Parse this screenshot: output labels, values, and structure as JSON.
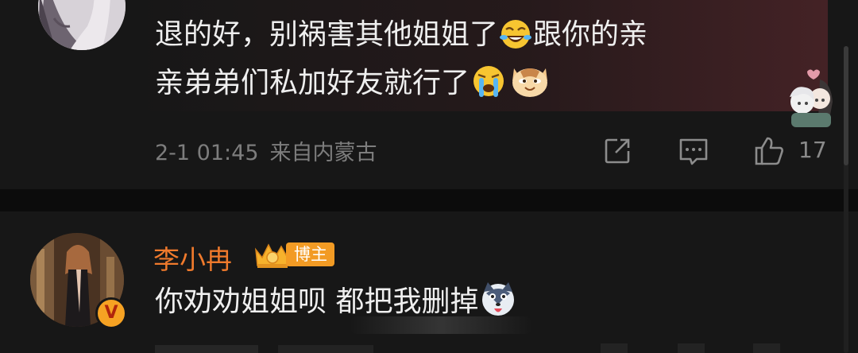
{
  "comment_top": {
    "text_line1_part1": "退的好，别祸害其他姐姐了",
    "text_line1_emoji": "laughing-crying-emoji",
    "text_line1_part2": "跟你的亲",
    "text_line2_part1": "亲弟弟们私加好友就行了",
    "text_line2_emoji1": "loudly-crying-emoji",
    "text_line2_emoji2": "doge-cat-emoji",
    "timestamp": "2-1 01:45",
    "location": "来自内蒙古",
    "like_count": "17",
    "actions": [
      "share-icon",
      "comment-icon",
      "like-icon"
    ]
  },
  "comment_bottom": {
    "username": "李小冉",
    "badge_label": "博主",
    "verified_mark": "V",
    "text": "你劝劝姐姐呗 都把我删掉",
    "text_emoji": "husky-emoji"
  },
  "colors": {
    "background": "#141414",
    "card": "#171717",
    "text": "#efefef",
    "meta": "#7d7d7d",
    "username": "#f07a2c",
    "badge": "#f29b24"
  }
}
